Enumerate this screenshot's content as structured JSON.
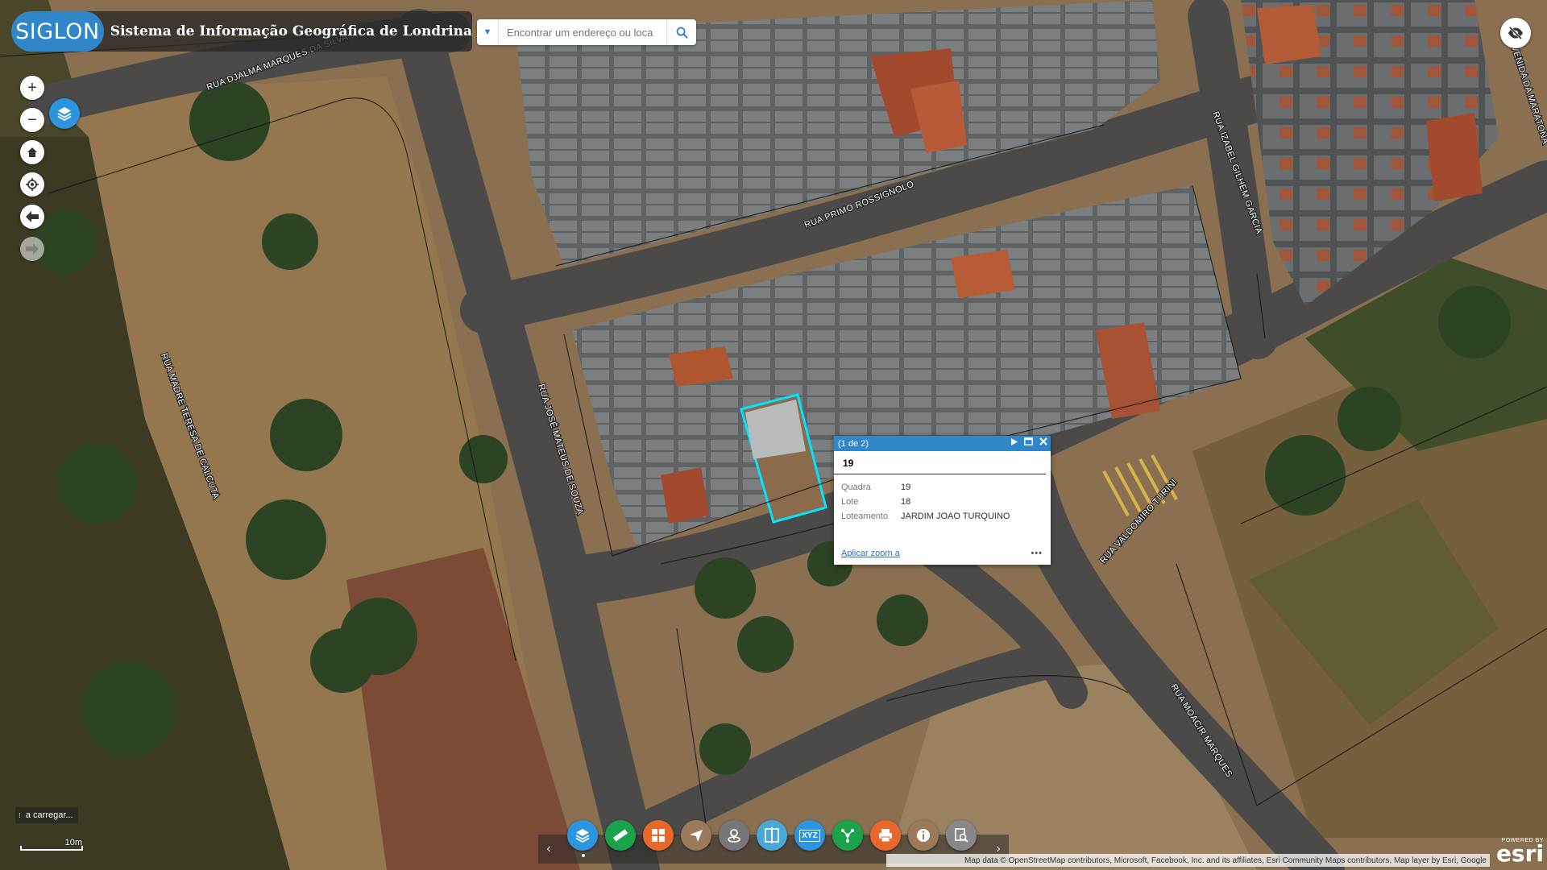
{
  "header": {
    "logo_text": "SIGLON",
    "title": "Sistema de Informação Geográfica de Londrina"
  },
  "search": {
    "placeholder": "Encontrar um endereço ou loca",
    "value": ""
  },
  "map_controls": {
    "zoom_in": "+",
    "zoom_out": "−"
  },
  "streets": [
    "RUA DJALMA MARQUES DA SILVA",
    "RUA PRIMO ROSSIGNOLO",
    "RUA IZABEL GILHEM GARCIA",
    "VENIDA DA MARATONA",
    "RUA MADRE TERESA DE CALCUTA",
    "RUA JOSÉ MATEUS DE SOUZA",
    "RUA VALDOMIRO TURINI",
    "RUA MOACIR MARQUES"
  ],
  "popup": {
    "counter": "(1 de 2)",
    "title": "19",
    "fields": [
      {
        "key": "Quadra",
        "value": "19"
      },
      {
        "key": "Lote",
        "value": "18"
      },
      {
        "key": "Loteamento",
        "value": "JARDIM JOAO TURQUINO"
      }
    ],
    "zoom_link": "Aplicar zoom a",
    "more": "•••"
  },
  "status": {
    "loading": "a carregar..."
  },
  "scale": {
    "label": "10m"
  },
  "toolbar": {
    "buttons": [
      {
        "name": "layers",
        "color": "#2b95e0"
      },
      {
        "name": "measure",
        "color": "#1aa34a"
      },
      {
        "name": "basemap-gallery",
        "color": "#e8682a"
      },
      {
        "name": "draw",
        "color": "#9a7a5a"
      },
      {
        "name": "locate",
        "color": "#777777"
      },
      {
        "name": "swipe",
        "color": "#4aa8d8"
      },
      {
        "name": "coordinates",
        "color": "#2b95e0"
      },
      {
        "name": "geoprocessing",
        "color": "#1aa34a"
      },
      {
        "name": "print",
        "color": "#e8682a"
      },
      {
        "name": "about",
        "color": "#9a7a5a"
      },
      {
        "name": "query",
        "color": "#888888"
      }
    ],
    "coord_label": "XYZ"
  },
  "attribution": {
    "text": "Map data © OpenStreetMap contributors, Microsoft, Facebook, Inc. and its affiliates, Esri Community Maps contributors, Map layer by Esri, Google"
  },
  "esri": {
    "powered_by": "POWERED BY",
    "brand": "esri"
  },
  "colors": {
    "accent": "#2f86c8",
    "selection": "#00e5ff"
  }
}
